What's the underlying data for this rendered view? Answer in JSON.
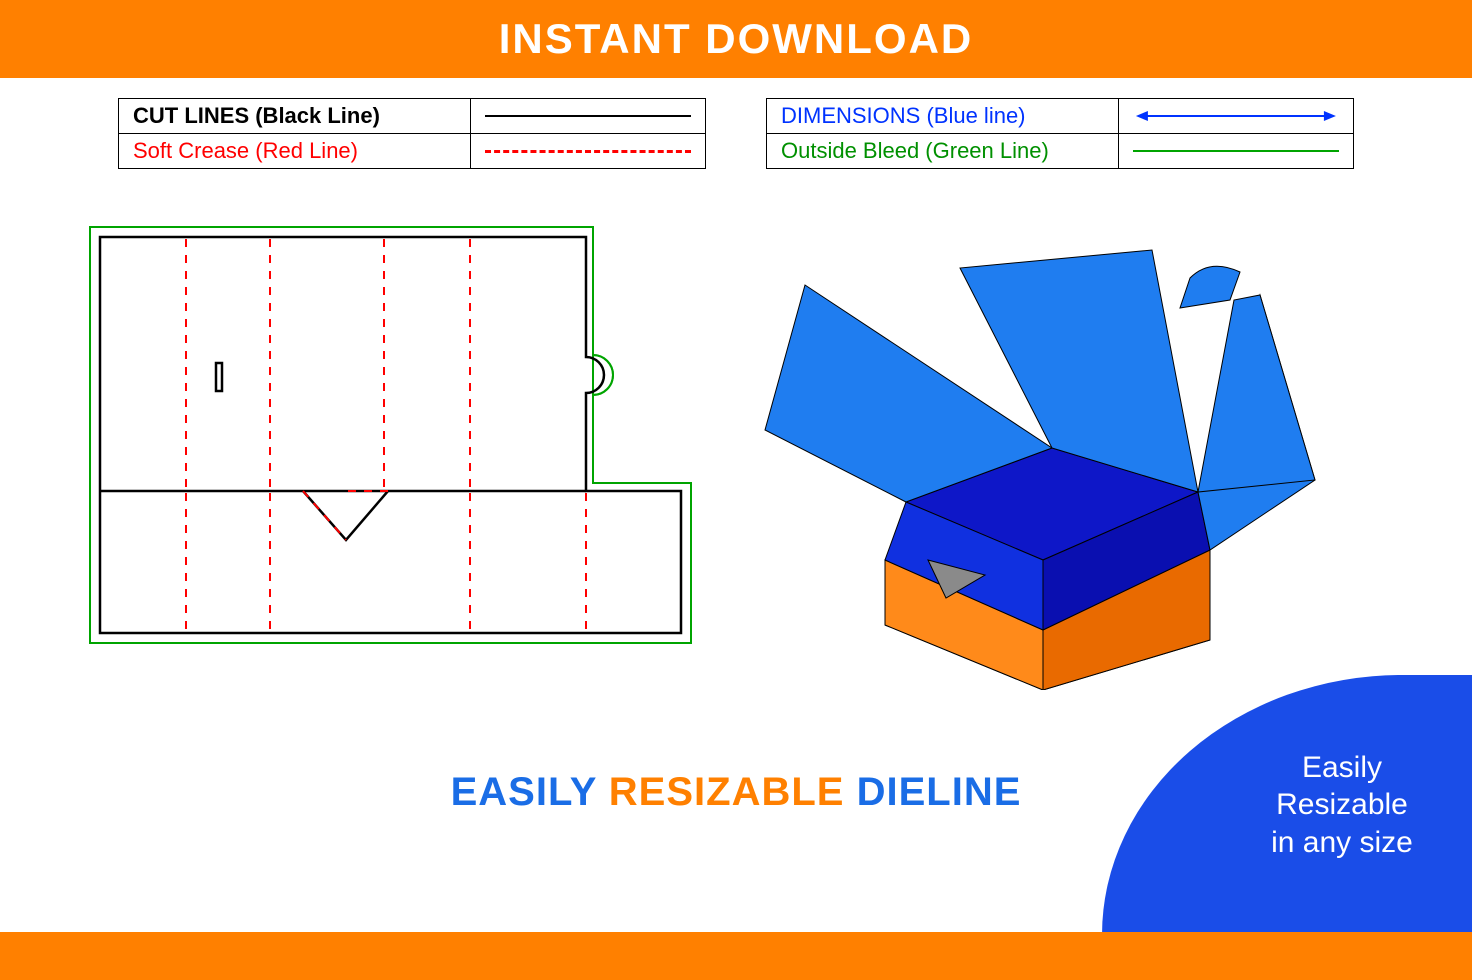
{
  "top_banner": "INSTANT DOWNLOAD",
  "legend_left": {
    "row1": {
      "label": "CUT LINES (Black Line)",
      "color": "#000000",
      "style": "solid"
    },
    "row2": {
      "label": "Soft Crease (Red Line)",
      "color": "#ff0000",
      "style": "dashed"
    }
  },
  "legend_right": {
    "row1": {
      "label": "DIMENSIONS (Blue line)",
      "color": "#0033ff",
      "style": "arrow"
    },
    "row2": {
      "label": "Outside Bleed (Green Line)",
      "color": "#00a400",
      "style": "solid"
    }
  },
  "tagline": {
    "w1": "EASILY",
    "w2": "RESIZABLE",
    "w3": "DIELINE"
  },
  "corner_badge": {
    "line1": "Easily",
    "line2": "Resizable",
    "line3": "in any size"
  },
  "colors": {
    "orange": "#ff8000",
    "blue_light": "#1f7df0",
    "blue_dark": "#0b1fd2",
    "green": "#00a400",
    "red": "#ff0000"
  }
}
